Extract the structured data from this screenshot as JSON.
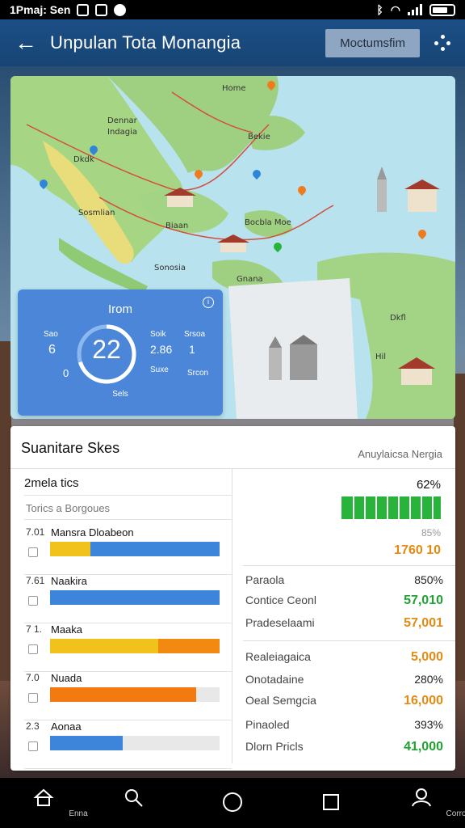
{
  "status_bar": {
    "left_text": "1Pmaj: Sen"
  },
  "app_bar": {
    "title": "Unpulan Tota Monangia",
    "action_label": "Moctumsfim"
  },
  "map": {
    "labels": [
      "Dennar",
      "Indagia",
      "Home",
      "Dkdk",
      "Bekie",
      "Sosmlian",
      "Biaan",
      "Bocbla Moe",
      "Sonosia",
      "Gnana",
      "Dkfl",
      "Hil"
    ]
  },
  "widget": {
    "title": "Irom",
    "value": "22",
    "left_top": "Sao",
    "left_val": "6",
    "left_bottom": "0",
    "right_a": "Soik",
    "right_b": "2.86",
    "right_c": "Suxe",
    "right_d": "Srsoa",
    "right_e": "1",
    "right_f": "Srcon",
    "footer": "Sels"
  },
  "panel": {
    "title": "Suanitare Skes",
    "subtitle": "Anuylaicsa Nergia",
    "list_header": "2mela tics",
    "list_sub": "Torics a Borgoues",
    "rows": [
      {
        "num": "7.01",
        "name": "Mansra Dloabeon",
        "pct": 1.0,
        "color": "#3d84db",
        "accent": "#f2c21c",
        "accent_pct": 0.24
      },
      {
        "num": "7.61",
        "name": "Naakira",
        "pct": 1.0,
        "color": "#3d84db",
        "accent": "",
        "accent_pct": 0
      },
      {
        "num": "7 1.",
        "name": "Maaka",
        "pct": 1.0,
        "color": "#f28a11",
        "accent": "#f2c21c",
        "accent_pct": 0.64
      },
      {
        "num": "7.0",
        "name": "Nuada",
        "pct": 0.86,
        "color": "#f27a10",
        "accent": "",
        "accent_pct": 0
      },
      {
        "num": "2.3",
        "name": "Aonaa",
        "pct": 0.43,
        "color": "#3d84db",
        "accent": "",
        "accent_pct": 0
      }
    ],
    "right_top_pct": "62%",
    "right_small_1": "85%",
    "right_big_1": "1760 10",
    "stats": [
      {
        "label": "Paraola",
        "value": "850%",
        "style": ""
      },
      {
        "label": "Contice Ceonl",
        "value": "57,010",
        "style": "g"
      },
      {
        "label": "Pradeselaami",
        "value": "57,001",
        "style": "o"
      },
      {
        "label": "Realeiagaica",
        "value": "5,000",
        "style": "o"
      },
      {
        "label": "Onotadaine",
        "value": "280%",
        "style": ""
      },
      {
        "label": "Oeal Semgcia",
        "value": "16,000",
        "style": "o"
      },
      {
        "label": "Pinaoled",
        "value": "393%",
        "style": ""
      },
      {
        "label": "Dlorn Pricls",
        "value": "41,000",
        "style": "g"
      }
    ]
  },
  "nav": {
    "home": "Enna",
    "search": "",
    "account": "Corro"
  }
}
